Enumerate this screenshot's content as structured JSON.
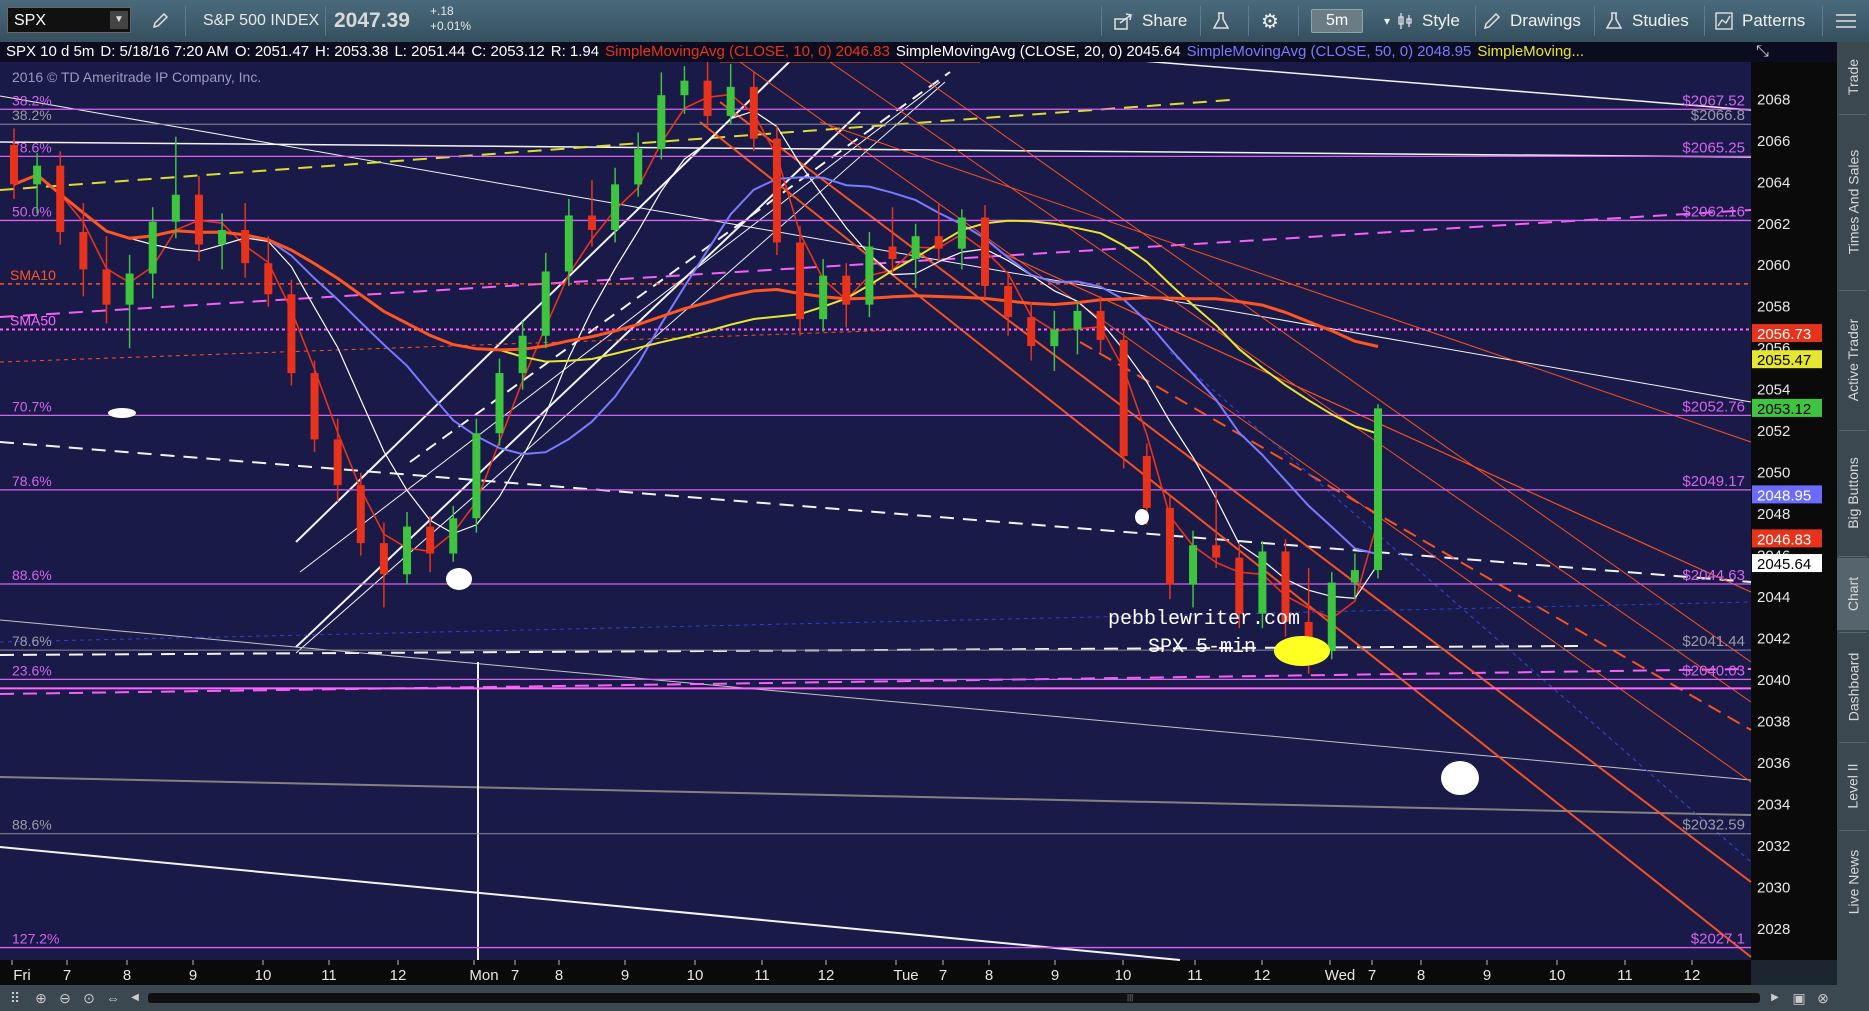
{
  "toolbar": {
    "symbol": "SPX",
    "instrument_name": "S&P 500 INDEX",
    "last_price": "2047.39",
    "change_abs": "+.18",
    "change_pct": "+0.01%",
    "share_label": "Share",
    "timeframe_label": "5m",
    "style_label": "Style",
    "drawings_label": "Drawings",
    "studies_label": "Studies",
    "patterns_label": "Patterns"
  },
  "infobar": {
    "spec": "SPX 10 d 5m",
    "date": "D: 5/18/16 7:20 AM",
    "open": "O: 2051.47",
    "high": "H: 2053.38",
    "low": "L: 2051.44",
    "close": "C: 2053.12",
    "range": "R: 1.94",
    "sma10_label": "SimpleMovingAvg (CLOSE, 10, 0)",
    "sma10_value": "2046.83",
    "sma20_label": "SimpleMovingAvg (CLOSE, 20, 0)",
    "sma20_value": "2045.64",
    "sma50_label": "SimpleMovingAvg (CLOSE, 50, 0)",
    "sma50_value": "2048.95",
    "sma_more_label": "SimpleMoving..."
  },
  "sidebar": {
    "tabs": [
      "Trade",
      "Times And Sales",
      "Active Trader",
      "Big Buttons",
      "Chart",
      "Dashboard",
      "Level II",
      "Live News"
    ]
  },
  "colors": {
    "plot_bg": "#1a1a48",
    "up_candle": "#3ec43e",
    "down_candle": "#e8331c",
    "sma10": "#e8331c",
    "sma20": "#ffffff",
    "sma50": "#7a7aff",
    "sma100": "#e6e631",
    "sma200": "#ff5522",
    "fib": "#d464f0",
    "axis_bg": "#0a0a0a"
  },
  "chart_data": {
    "type": "candlestick",
    "copyright": "2016 © TD Ameritrade IP Company, Inc.",
    "annotation_site": "pebblewriter.com",
    "annotation_title": "SPX 5-min",
    "ylim": [
      2026.5,
      2069.8
    ],
    "y_ticks": [
      2028,
      2030,
      2032,
      2034,
      2036,
      2038,
      2040,
      2042,
      2044,
      2046,
      2048,
      2050,
      2052,
      2054,
      2056,
      2058,
      2060,
      2062,
      2064,
      2066,
      2068
    ],
    "x_ticks": [
      "Fri",
      "7",
      "8",
      "9",
      "10",
      "11",
      "12",
      "Mon",
      "7",
      "8",
      "9",
      "10",
      "11",
      "12",
      "Tue",
      "7",
      "8",
      "9",
      "10",
      "11",
      "12",
      "Wed",
      "7",
      "8",
      "9",
      "10",
      "11",
      "12"
    ],
    "fib_levels": [
      {
        "pct": "38.2%",
        "price": 2067.52,
        "label": "$2067.52"
      },
      {
        "pct": "78.6%",
        "price": 2065.25,
        "label": "$2065.25"
      },
      {
        "pct": "50.0%",
        "price": 2062.16,
        "label": "$2062.16"
      },
      {
        "pct": "70.7%",
        "price": 2052.76,
        "label": "$2052.76"
      },
      {
        "pct": "78.6%",
        "price": 2049.17,
        "label": "$2049.17"
      },
      {
        "pct": "88.6%",
        "price": 2044.63,
        "label": "$2044.63"
      },
      {
        "pct": "23.6%",
        "price": 2040.03,
        "label": "$2040.03"
      },
      {
        "pct": "127.2%",
        "price": 2027.1,
        "label": "$2027.1"
      }
    ],
    "grey_levels": [
      {
        "pct": "38.2%",
        "price": 2066.8,
        "label": "$2066.8"
      },
      {
        "pct": "78.6%",
        "price": 2041.44,
        "label": "$2041.44"
      },
      {
        "pct": "88.6%",
        "price": 2032.59,
        "label": "$2032.59"
      }
    ],
    "sma_line_labels": [
      "SMA10",
      "SMA50"
    ],
    "price_tags": [
      {
        "label": "2056.73",
        "price": 2056.73,
        "color": "#e8331c"
      },
      {
        "label": "2055.47",
        "price": 2055.47,
        "color": "#e6e631"
      },
      {
        "label": "2053.12",
        "price": 2053.12,
        "color": "#3ec43e"
      },
      {
        "label": "2048.95",
        "price": 2048.95,
        "color": "#6b6bff"
      },
      {
        "label": "2046.83",
        "price": 2046.83,
        "color": "#e8331c"
      },
      {
        "label": "2045.64",
        "price": 2045.64,
        "color": "#ffffff"
      }
    ],
    "series": [
      {
        "name": "SimpleMovingAvg (CLOSE, 10, 0)",
        "last": 2046.83
      },
      {
        "name": "SimpleMovingAvg (CLOSE, 20, 0)",
        "last": 2045.64
      },
      {
        "name": "SimpleMovingAvg (CLOSE, 50, 0)",
        "last": 2048.95
      }
    ],
    "candles": [
      {
        "o": 2065.8,
        "h": 2066.6,
        "l": 2063.2,
        "c": 2063.9
      },
      {
        "o": 2063.9,
        "h": 2065.4,
        "l": 2062.5,
        "c": 2064.8
      },
      {
        "o": 2064.8,
        "h": 2065.5,
        "l": 2061.0,
        "c": 2061.6
      },
      {
        "o": 2061.6,
        "h": 2063.0,
        "l": 2058.5,
        "c": 2059.8
      },
      {
        "o": 2059.8,
        "h": 2061.4,
        "l": 2057.2,
        "c": 2058.1
      },
      {
        "o": 2058.1,
        "h": 2060.5,
        "l": 2056.0,
        "c": 2059.6
      },
      {
        "o": 2059.6,
        "h": 2062.8,
        "l": 2058.4,
        "c": 2062.1
      },
      {
        "o": 2062.1,
        "h": 2066.2,
        "l": 2061.3,
        "c": 2063.4
      },
      {
        "o": 2063.4,
        "h": 2064.3,
        "l": 2060.2,
        "c": 2061.0
      },
      {
        "o": 2061.0,
        "h": 2062.5,
        "l": 2059.8,
        "c": 2061.7
      },
      {
        "o": 2061.7,
        "h": 2063.0,
        "l": 2059.4,
        "c": 2060.1
      },
      {
        "o": 2060.1,
        "h": 2061.4,
        "l": 2058.0,
        "c": 2058.6
      },
      {
        "o": 2058.6,
        "h": 2059.3,
        "l": 2054.2,
        "c": 2054.8
      },
      {
        "o": 2054.8,
        "h": 2055.4,
        "l": 2051.0,
        "c": 2051.6
      },
      {
        "o": 2051.6,
        "h": 2052.6,
        "l": 2048.6,
        "c": 2049.4
      },
      {
        "o": 2049.4,
        "h": 2050.0,
        "l": 2046.0,
        "c": 2046.6
      },
      {
        "o": 2046.6,
        "h": 2047.6,
        "l": 2043.5,
        "c": 2045.1
      },
      {
        "o": 2045.1,
        "h": 2048.1,
        "l": 2044.6,
        "c": 2047.4
      },
      {
        "o": 2047.4,
        "h": 2047.9,
        "l": 2045.2,
        "c": 2046.1
      },
      {
        "o": 2046.1,
        "h": 2048.4,
        "l": 2045.7,
        "c": 2047.8
      },
      {
        "o": 2047.8,
        "h": 2052.6,
        "l": 2047.1,
        "c": 2051.9
      },
      {
        "o": 2051.9,
        "h": 2055.5,
        "l": 2051.3,
        "c": 2054.8
      },
      {
        "o": 2054.8,
        "h": 2057.3,
        "l": 2054.0,
        "c": 2056.6
      },
      {
        "o": 2056.6,
        "h": 2060.6,
        "l": 2056.0,
        "c": 2059.7
      },
      {
        "o": 2059.7,
        "h": 2063.2,
        "l": 2059.0,
        "c": 2062.4
      },
      {
        "o": 2062.4,
        "h": 2064.1,
        "l": 2060.9,
        "c": 2061.7
      },
      {
        "o": 2061.7,
        "h": 2064.7,
        "l": 2061.1,
        "c": 2063.9
      },
      {
        "o": 2063.9,
        "h": 2066.4,
        "l": 2063.3,
        "c": 2065.6
      },
      {
        "o": 2065.6,
        "h": 2069.3,
        "l": 2065.1,
        "c": 2068.2
      },
      {
        "o": 2068.2,
        "h": 2069.6,
        "l": 2067.3,
        "c": 2068.9
      },
      {
        "o": 2068.9,
        "h": 2070.0,
        "l": 2066.6,
        "c": 2067.2
      },
      {
        "o": 2067.2,
        "h": 2069.7,
        "l": 2066.8,
        "c": 2068.6
      },
      {
        "o": 2068.6,
        "h": 2069.3,
        "l": 2065.5,
        "c": 2066.1
      },
      {
        "o": 2066.1,
        "h": 2066.7,
        "l": 2060.5,
        "c": 2061.1
      },
      {
        "o": 2061.1,
        "h": 2061.9,
        "l": 2056.6,
        "c": 2057.4
      },
      {
        "o": 2057.4,
        "h": 2060.3,
        "l": 2056.8,
        "c": 2059.5
      },
      {
        "o": 2059.5,
        "h": 2060.1,
        "l": 2057.0,
        "c": 2058.1
      },
      {
        "o": 2058.1,
        "h": 2061.6,
        "l": 2057.5,
        "c": 2060.9
      },
      {
        "o": 2060.9,
        "h": 2062.8,
        "l": 2059.6,
        "c": 2060.3
      },
      {
        "o": 2060.3,
        "h": 2062.0,
        "l": 2058.9,
        "c": 2061.4
      },
      {
        "o": 2061.4,
        "h": 2063.0,
        "l": 2060.2,
        "c": 2060.8
      },
      {
        "o": 2060.8,
        "h": 2062.7,
        "l": 2059.8,
        "c": 2062.3
      },
      {
        "o": 2062.3,
        "h": 2062.9,
        "l": 2058.4,
        "c": 2059.0
      },
      {
        "o": 2059.0,
        "h": 2059.6,
        "l": 2056.6,
        "c": 2057.5
      },
      {
        "o": 2057.5,
        "h": 2058.2,
        "l": 2055.4,
        "c": 2056.1
      },
      {
        "o": 2056.1,
        "h": 2057.8,
        "l": 2054.9,
        "c": 2056.9
      },
      {
        "o": 2056.9,
        "h": 2058.3,
        "l": 2055.7,
        "c": 2057.8
      },
      {
        "o": 2057.8,
        "h": 2058.5,
        "l": 2055.8,
        "c": 2056.4
      },
      {
        "o": 2056.4,
        "h": 2056.9,
        "l": 2050.2,
        "c": 2050.8
      },
      {
        "o": 2050.8,
        "h": 2051.4,
        "l": 2047.5,
        "c": 2048.3
      },
      {
        "o": 2048.3,
        "h": 2048.9,
        "l": 2043.9,
        "c": 2044.6
      },
      {
        "o": 2044.6,
        "h": 2047.2,
        "l": 2043.5,
        "c": 2046.5
      },
      {
        "o": 2046.5,
        "h": 2049.1,
        "l": 2045.4,
        "c": 2045.9
      },
      {
        "o": 2045.9,
        "h": 2046.6,
        "l": 2042.5,
        "c": 2043.2
      },
      {
        "o": 2043.2,
        "h": 2046.7,
        "l": 2042.5,
        "c": 2046.2
      },
      {
        "o": 2046.2,
        "h": 2046.8,
        "l": 2042.1,
        "c": 2042.8
      },
      {
        "o": 2042.8,
        "h": 2045.4,
        "l": 2040.3,
        "c": 2041.4
      },
      {
        "o": 2041.4,
        "h": 2045.2,
        "l": 2041.0,
        "c": 2044.7
      },
      {
        "o": 2044.7,
        "h": 2046.1,
        "l": 2043.9,
        "c": 2045.3
      },
      {
        "o": 2045.3,
        "h": 2053.3,
        "l": 2044.9,
        "c": 2053.1
      }
    ]
  }
}
